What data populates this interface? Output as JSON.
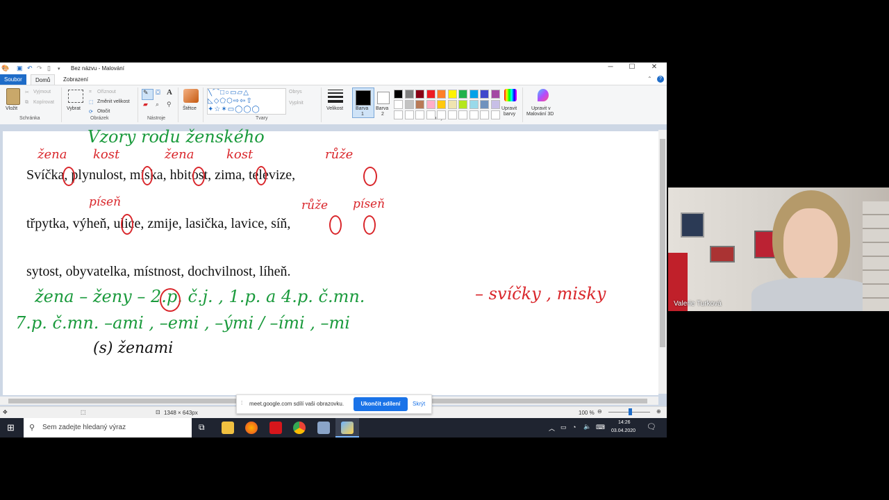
{
  "window": {
    "title": "Bez názvu - Malování",
    "controls": [
      "─",
      "☐",
      "✕"
    ]
  },
  "tabs": [
    "Soubor",
    "Domů",
    "Zobrazení"
  ],
  "ribbon": {
    "clipboard": {
      "paste": "Vložit",
      "cut": "Vyjmout",
      "copy": "Kopírovat",
      "label": "Schránka"
    },
    "image": {
      "select": "Vybrat",
      "crop": "Oříznout",
      "resize": "Změnit velikost",
      "rotate": "Otočit",
      "label": "Obrázek"
    },
    "tools": {
      "label": "Nástroje"
    },
    "brushes": {
      "label": "Štětce"
    },
    "shapes": {
      "outline": "Obrys",
      "fill": "Vyplnit",
      "label": "Tvary"
    },
    "size": {
      "label": "Velikost"
    },
    "color1": {
      "line1": "Barva",
      "line2": "1"
    },
    "color2": {
      "line1": "Barva",
      "line2": "2"
    },
    "edit_colors": {
      "line1": "Upravit",
      "line2": "barvy"
    },
    "paint3d": {
      "line1": "Upravit v",
      "line2": "Malování 3D"
    },
    "colors": {
      "label": "Barvy"
    },
    "palette_row1": [
      "#000000",
      "#7f7f7f",
      "#880015",
      "#ed1c24",
      "#ff7f27",
      "#fff200",
      "#22b14c",
      "#00a2e8",
      "#3f48cc",
      "#a349a4"
    ],
    "palette_row2": [
      "#ffffff",
      "#c3c3c3",
      "#b97a57",
      "#ffaec9",
      "#ffc90e",
      "#efe4b0",
      "#b5e61d",
      "#99d9ea",
      "#7092be",
      "#c8bfe7"
    ]
  },
  "canvas": {
    "printed_lines": [
      "Svíčka,  plynulost,  miska,  hbitost,  zima,  televize,",
      "třpytka,  výheň,  ulice,  zmije,  lasička,  lavice,  síň,",
      "sytost,  obyvatelka,  místnost,  dochvilnost,  líheň."
    ],
    "handwriting": {
      "heading": "Vzory rodu ženského",
      "over_svicka": "žena",
      "over_plynulost": "kost",
      "over_miska": "žena",
      "over_hbitost": "kost",
      "over_televize": "růže",
      "over_vyhen": "píseň",
      "over_lavice": "růže",
      "over_sin": "píseň",
      "line1_green": "žena – ženy – 2.p. č.j. , 1.p. a 4.p. č.mn.",
      "line1_red": "– svíčky , misky",
      "line2": "7.p. č.mn. –ami , –emi , –ými / –ími , –mi",
      "line3": "(s) ženami"
    }
  },
  "statusbar": {
    "dimensions": "1348 × 643px",
    "zoom": "100 %"
  },
  "share_bar": {
    "text": "meet.google.com sdílí vaši obrazovku.",
    "stop": "Ukončit sdílení",
    "hide": "Skrýt"
  },
  "taskbar": {
    "search_placeholder": "Sem zadejte hledaný výraz",
    "time": "14:26",
    "date": "03.04.2020"
  },
  "webcam": {
    "name": "Valerie Turková"
  }
}
